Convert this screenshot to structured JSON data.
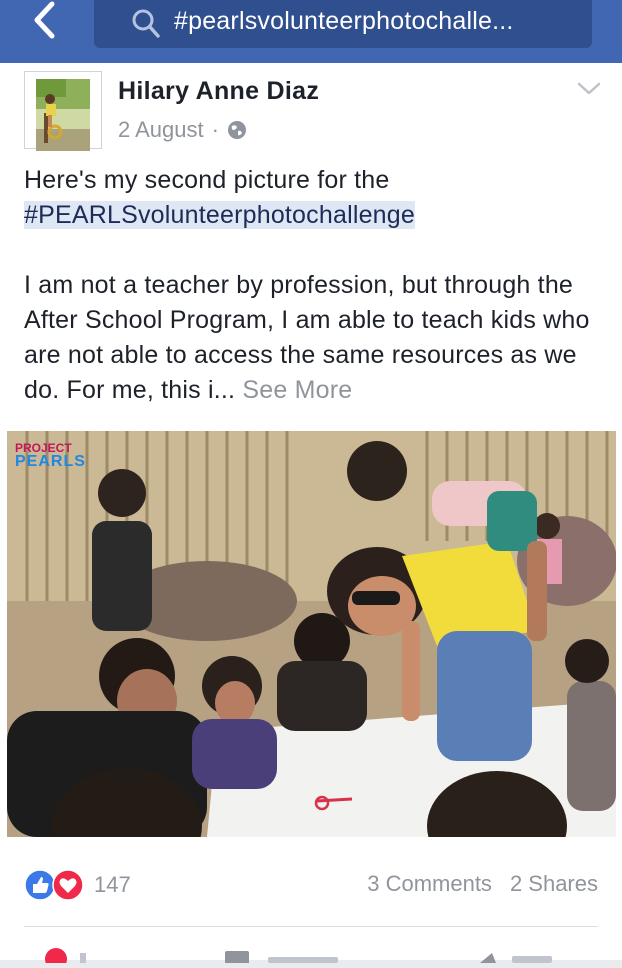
{
  "search": {
    "query": "#pearlsvolunteerphotochalle..."
  },
  "post": {
    "author": "Hilary Anne Diaz",
    "date": "2 August",
    "separator": "·",
    "text_line1": "Here's my second picture for the",
    "hashtag": "#PEARLSvolunteerphotochallenge",
    "body": "I am not a teacher by profession, but through the After School Program, I am able to teach kids who are not able to access the same resources as we do. For me, this i...",
    "see_more": "See More",
    "photo_logo_line1": "PROJECT",
    "photo_logo_line2": "PEARLS"
  },
  "engagement": {
    "reaction_count": "147",
    "comments": "3 Comments",
    "shares": "2 Shares"
  },
  "colors": {
    "brand": "#4267b2",
    "search_box": "#2f4f8f",
    "like_blue": "#3b79e8",
    "love_red": "#f0284a",
    "hashtag_bg": "#dfe7f5"
  },
  "icons": [
    "back-arrow-icon",
    "search-icon",
    "globe-icon",
    "chevron-down-icon",
    "like-icon",
    "love-icon"
  ]
}
